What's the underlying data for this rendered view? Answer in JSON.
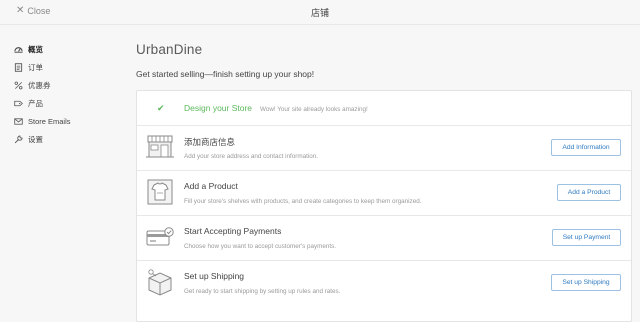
{
  "topbar": {
    "close_label": "Close",
    "title": "店铺"
  },
  "sidebar": {
    "items": [
      {
        "label": "概览",
        "icon": "dashboard-icon",
        "active": true
      },
      {
        "label": "订单",
        "icon": "orders-icon",
        "active": false
      },
      {
        "label": "优惠券",
        "icon": "percent-icon",
        "active": false
      },
      {
        "label": "产品",
        "icon": "tag-icon",
        "active": false
      },
      {
        "label": "Store Emails",
        "icon": "mail-icon",
        "active": false
      },
      {
        "label": "设置",
        "icon": "wrench-icon",
        "active": false
      }
    ]
  },
  "main": {
    "shop_name": "UrbanDine",
    "subtitle": "Get started selling—finish setting up your shop!",
    "steps": [
      {
        "title": "Design your Store",
        "description": "Wow! Your site already looks amazing!",
        "done": true,
        "icon": "check-icon"
      },
      {
        "title": "添加商店信息",
        "description": "Add your store address and contact information.",
        "button": "Add Information",
        "icon": "storefront-icon"
      },
      {
        "title": "Add a Product",
        "description": "Fill your store's shelves with products, and create categories to keep them organized.",
        "button": "Add a Product",
        "icon": "shirt-icon"
      },
      {
        "title": "Start Accepting Payments",
        "description": "Choose how you want to accept customer's payments.",
        "button": "Set up Payment",
        "icon": "credit-card-icon"
      },
      {
        "title": "Set up Shipping",
        "description": "Get ready to start shipping by setting up rules and rates.",
        "button": "Set up Shipping",
        "icon": "box-icon"
      }
    ]
  },
  "colors": {
    "accent": "#2e7ac0",
    "success": "#5cb85c",
    "background": "#f7f7f7"
  }
}
